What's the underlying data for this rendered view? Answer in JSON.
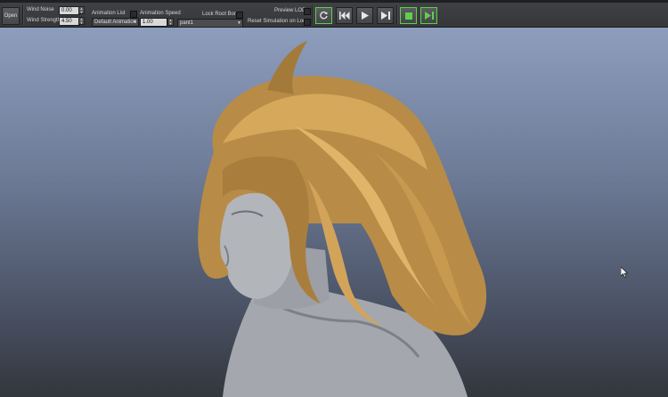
{
  "toolbar": {
    "open_label": "Open",
    "wind_noise_label": "Wind Noise",
    "wind_noise_value": "0.00",
    "wind_strength_label": "Wind Strength",
    "wind_strength_value": "4.50",
    "animation_list_label": "Animation List",
    "animation_list_value": "Default Animation",
    "animation_speed_label": "Animation Speed",
    "animation_speed_value": "1.00",
    "lock_root_bone_label": "Lock Root Bone",
    "bone_value": "pant1",
    "preview_lod_label": "Preview LOD",
    "reset_sim_label": "Reset Simulation on Loop"
  },
  "playback": {
    "buttons": [
      "reset-icon",
      "rewind-start-icon",
      "play-icon",
      "step-forward-icon",
      "stop-icon",
      "play-to-end-icon"
    ],
    "active_color": "#5fd04a"
  },
  "viewport": {
    "hair_color": "#c99a4e",
    "skin_color": "#a9acb1"
  }
}
